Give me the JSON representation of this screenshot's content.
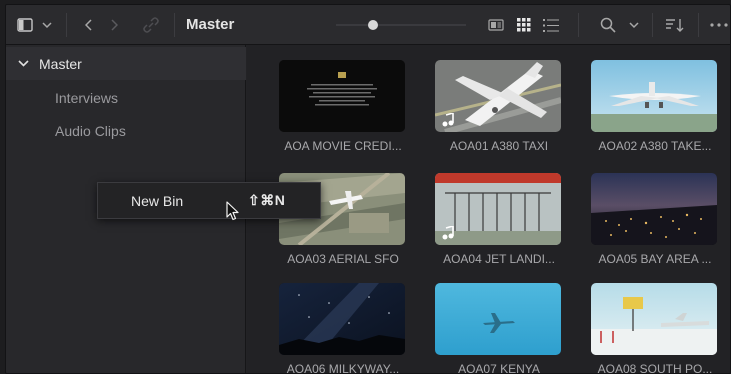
{
  "toolbar": {
    "title": "Master",
    "icons": [
      "sidebar-toggle-icon",
      "chevron-down-icon",
      "back-icon",
      "forward-icon",
      "link-icon",
      "metadata-view-icon",
      "thumbnail-view-icon",
      "list-view-icon",
      "search-icon",
      "chevron-down-icon",
      "sort-icon",
      "more-icon"
    ]
  },
  "sidebar": {
    "root": {
      "label": "Master",
      "expanded": true
    },
    "items": [
      {
        "label": "Interviews"
      },
      {
        "label": "Audio Clips"
      }
    ]
  },
  "context_menu": {
    "label": "New Bin",
    "shortcut": "⇧⌘N"
  },
  "clips": [
    {
      "label": "AOA MOVIE CREDI...",
      "has_audio": false
    },
    {
      "label": "AOA01 A380 TAXI",
      "has_audio": true
    },
    {
      "label": "AOA02 A380 TAKE...",
      "has_audio": false
    },
    {
      "label": "AOA03 AERIAL SFO",
      "has_audio": false
    },
    {
      "label": "AOA04 JET LANDI...",
      "has_audio": true
    },
    {
      "label": "AOA05 BAY AREA ...",
      "has_audio": false
    },
    {
      "label": "AOA06 MILKYWAY...",
      "has_audio": false
    },
    {
      "label": "AOA07 KENYA",
      "has_audio": false
    },
    {
      "label": "AOA08 SOUTH PO...",
      "has_audio": false
    }
  ],
  "colors": {
    "background": "#232326",
    "sidebar": "#28282b",
    "toolbar": "#2b2b2e",
    "text": "#c8c8c8"
  }
}
